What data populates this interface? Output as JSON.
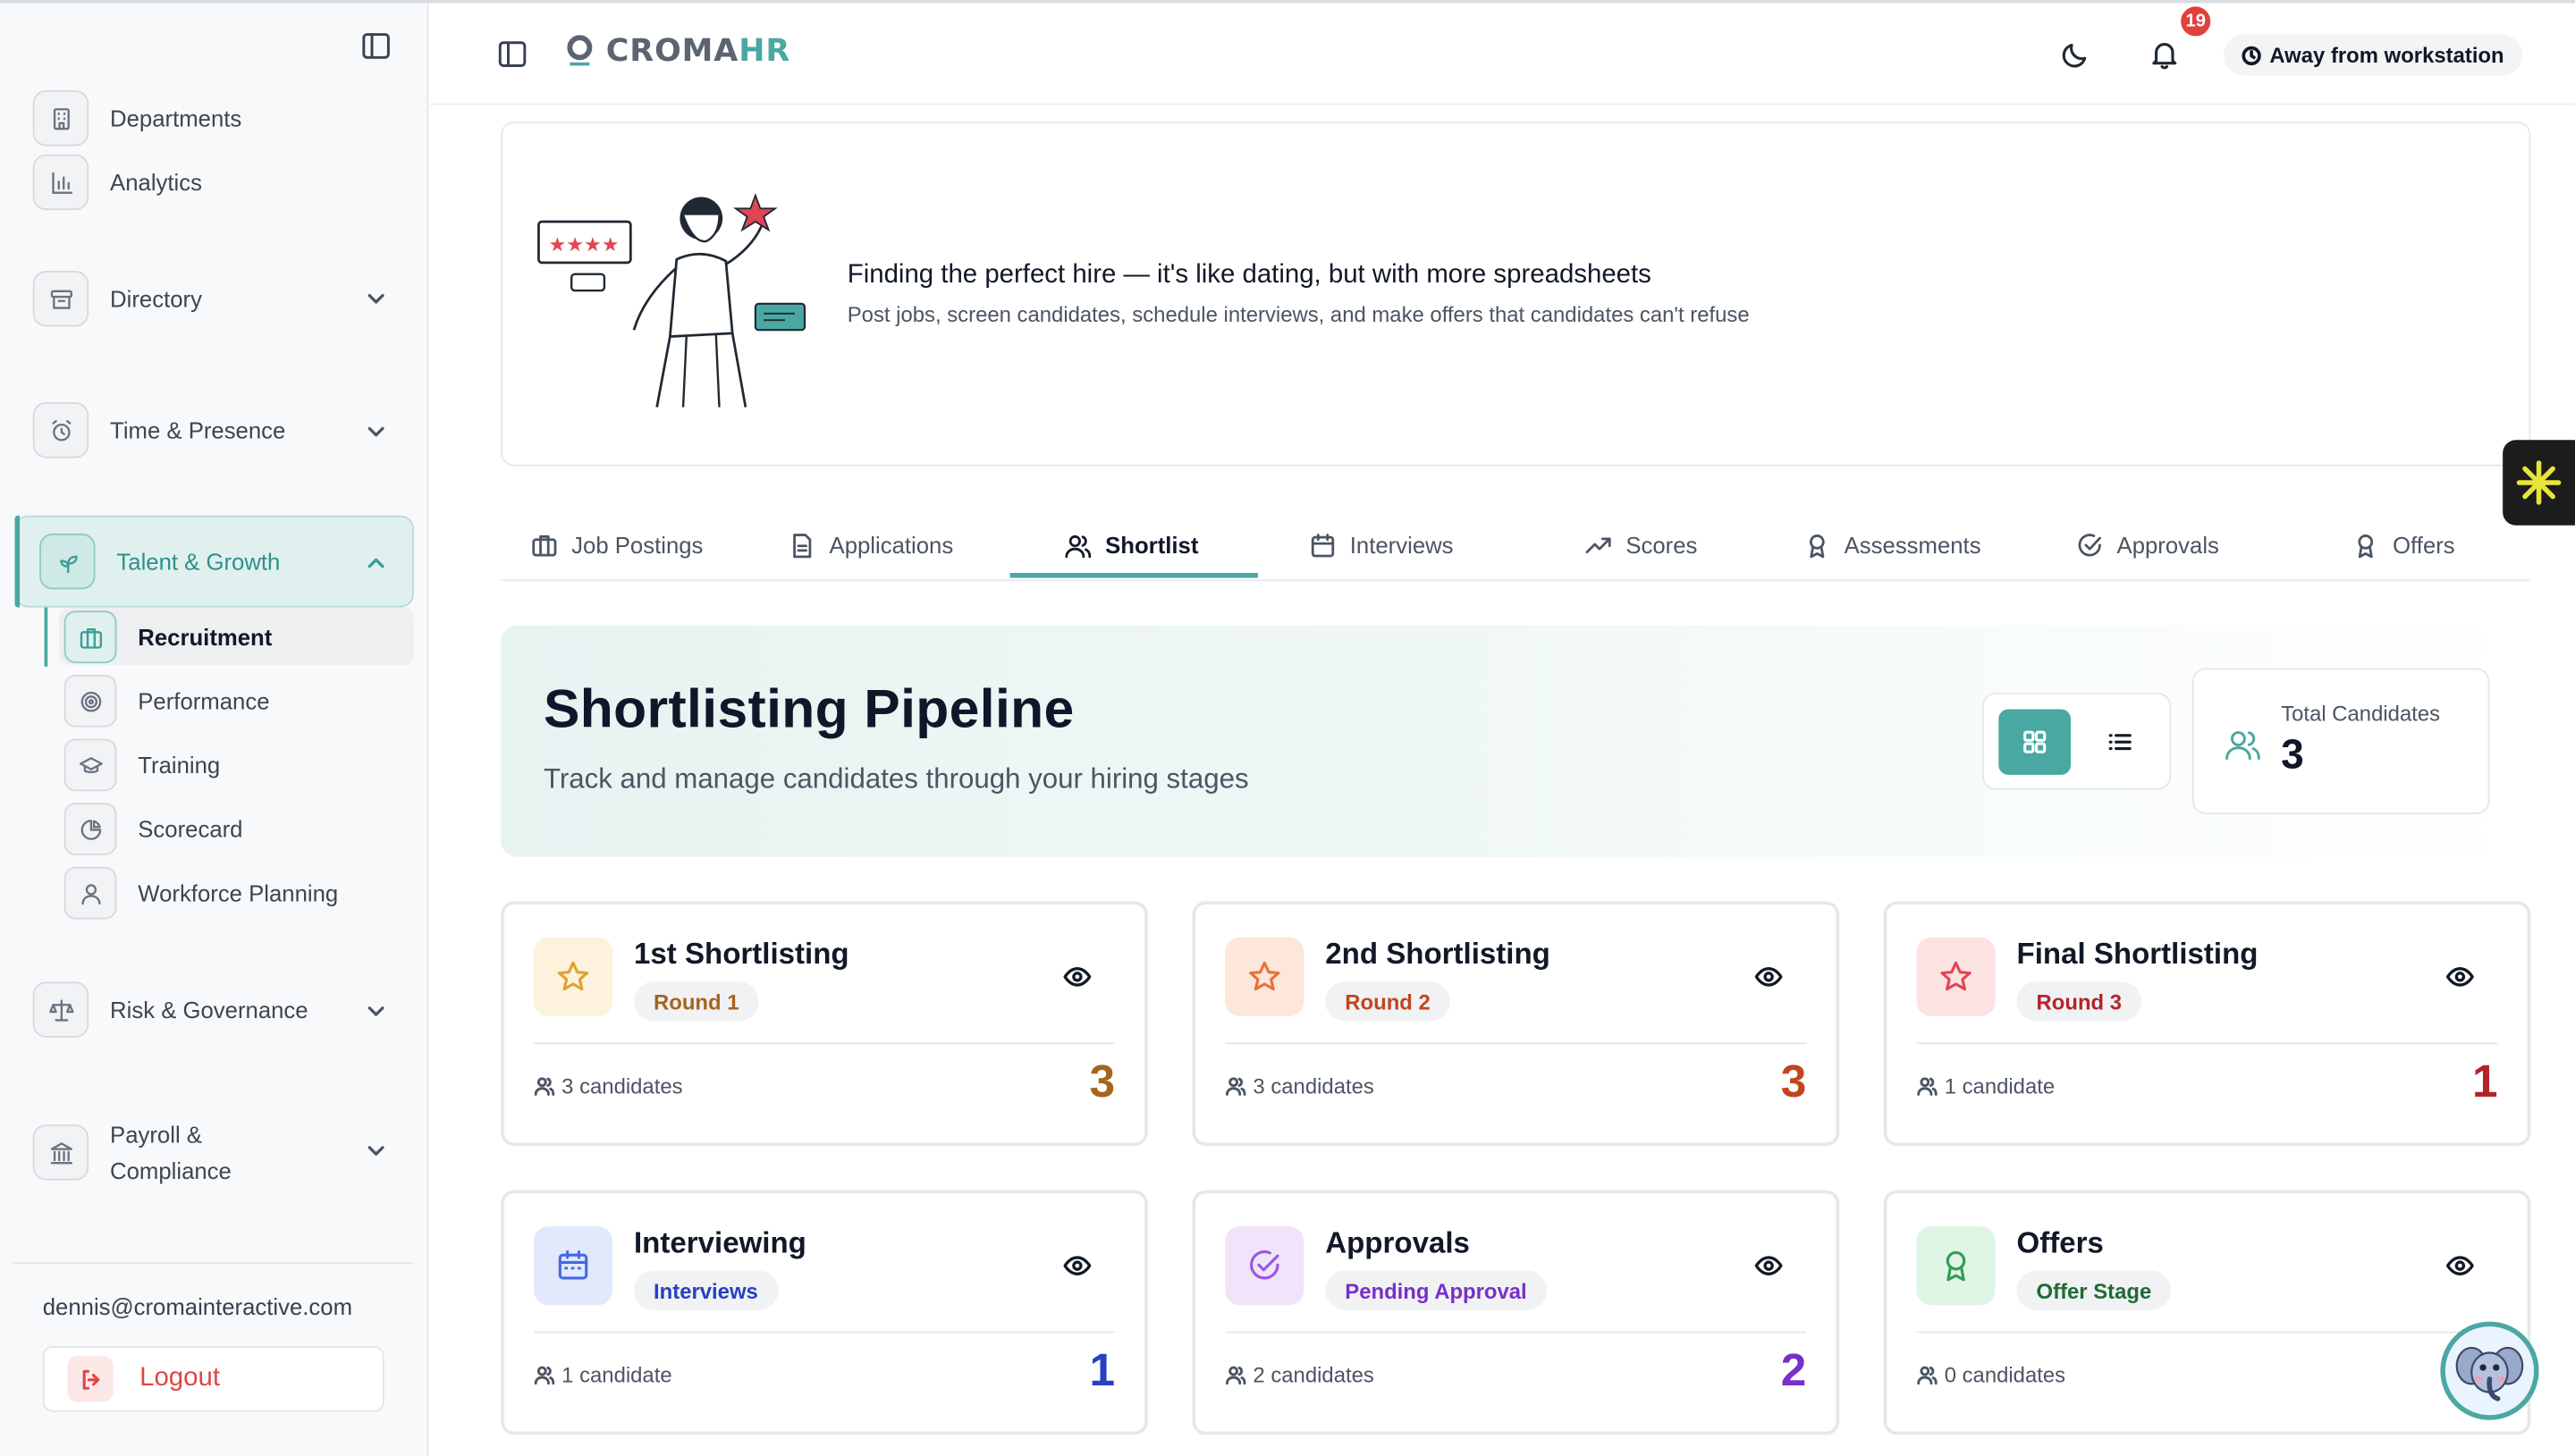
{
  "brand": {
    "logo_prefix": "CROMA",
    "logo_suffix": "HR"
  },
  "sidebar": {
    "items": [
      {
        "label": "Departments"
      },
      {
        "label": "Analytics"
      },
      {
        "label": "Directory"
      },
      {
        "label": "Time & Presence"
      },
      {
        "label": "Talent & Growth"
      },
      {
        "label": "Risk & Governance"
      },
      {
        "label": "Payroll &\nCompliance",
        "line1": "Payroll &",
        "line2": "Compliance"
      }
    ],
    "sub_items": [
      {
        "label": "Recruitment"
      },
      {
        "label": "Performance"
      },
      {
        "label": "Training"
      },
      {
        "label": "Scorecard"
      },
      {
        "label": "Workforce Planning"
      }
    ],
    "user_email": "dennis@cromainteractive.com",
    "logout_label": "Logout"
  },
  "header": {
    "notification_count": "19",
    "status_label": "Away from workstation"
  },
  "hero": {
    "title": "Finding the perfect hire — it's like dating, but with more spreadsheets",
    "subtitle": "Post jobs, screen candidates, schedule interviews, and make offers that candidates can't refuse"
  },
  "tabs": [
    {
      "label": "Job Postings",
      "icon": "briefcase-icon"
    },
    {
      "label": "Applications",
      "icon": "document-icon"
    },
    {
      "label": "Shortlist",
      "icon": "users-icon",
      "active": true
    },
    {
      "label": "Interviews",
      "icon": "calendar-icon"
    },
    {
      "label": "Scores",
      "icon": "trending-up-icon"
    },
    {
      "label": "Assessments",
      "icon": "award-icon"
    },
    {
      "label": "Approvals",
      "icon": "check-circle-icon"
    },
    {
      "label": "Offers",
      "icon": "award-icon"
    }
  ],
  "pipeline": {
    "title": "Shortlisting Pipeline",
    "subtitle": "Track and manage candidates through your hiring stages",
    "total_label": "Total Candidates",
    "total_value": "3"
  },
  "stages": [
    {
      "title": "1st Shortlisting",
      "badge": "Round 1",
      "count_label": "3 candidates",
      "count": "3",
      "icon": "star-icon",
      "accent": "#a5651d",
      "icon_bg": "#fdf2dc",
      "icon_stroke": "#e0a231",
      "badge_color": "#a5651d"
    },
    {
      "title": "2nd Shortlisting",
      "badge": "Round 2",
      "count_label": "3 candidates",
      "count": "3",
      "icon": "star-icon",
      "accent": "#c2451e",
      "icon_bg": "#fde6da",
      "icon_stroke": "#e8703a",
      "badge_color": "#c2451e"
    },
    {
      "title": "Final Shortlisting",
      "badge": "Round 3",
      "count_label": "1 candidate",
      "count": "1",
      "icon": "star-icon",
      "accent": "#b4232a",
      "icon_bg": "#fde2e2",
      "icon_stroke": "#e04555",
      "badge_color": "#b4232a"
    },
    {
      "title": "Interviewing",
      "badge": "Interviews",
      "count_label": "1 candidate",
      "count": "1",
      "icon": "calendar-icon",
      "accent": "#2741c2",
      "icon_bg": "#e2e9fc",
      "icon_stroke": "#4668e0",
      "badge_color": "#2741c2"
    },
    {
      "title": "Approvals",
      "badge": "Pending Approval",
      "count_label": "2 candidates",
      "count": "2",
      "icon": "check-circle-icon",
      "accent": "#7a2fc9",
      "icon_bg": "#f0e4fb",
      "icon_stroke": "#9b56e0",
      "badge_color": "#7a2fc9"
    },
    {
      "title": "Offers",
      "badge": "Offer Stage",
      "count_label": "0 candidates",
      "count": "",
      "icon": "award-icon",
      "accent": "#1f7a3f",
      "icon_bg": "#dff5e6",
      "icon_stroke": "#2f9e56",
      "badge_color": "#1f6b35"
    }
  ],
  "colors": {
    "accent": "#4aa8a2",
    "danger": "#e04545"
  }
}
